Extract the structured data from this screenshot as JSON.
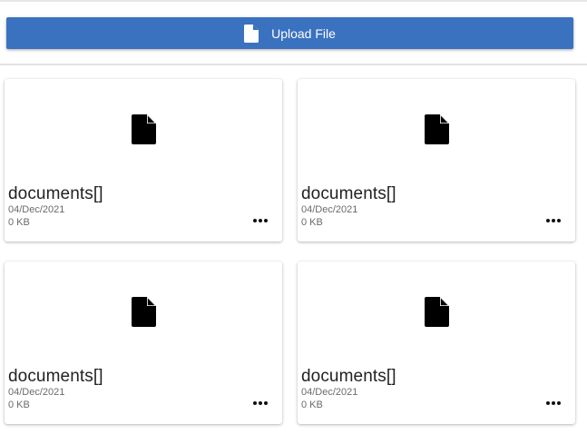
{
  "toolbar": {
    "upload_label": "Upload File",
    "upload_icon": "file-icon",
    "accent_color": "#3a72bf"
  },
  "files": [
    {
      "name": "documents[]",
      "date": "04/Dec/2021",
      "size": "0 KB",
      "icon": "file-icon",
      "menu_icon": "more-horizontal-icon"
    },
    {
      "name": "documents[]",
      "date": "04/Dec/2021",
      "size": "0 KB",
      "icon": "file-icon",
      "menu_icon": "more-horizontal-icon"
    },
    {
      "name": "documents[]",
      "date": "04/Dec/2021",
      "size": "0 KB",
      "icon": "file-icon",
      "menu_icon": "more-horizontal-icon"
    },
    {
      "name": "documents[]",
      "date": "04/Dec/2021",
      "size": "0 KB",
      "icon": "file-icon",
      "menu_icon": "more-horizontal-icon"
    }
  ]
}
